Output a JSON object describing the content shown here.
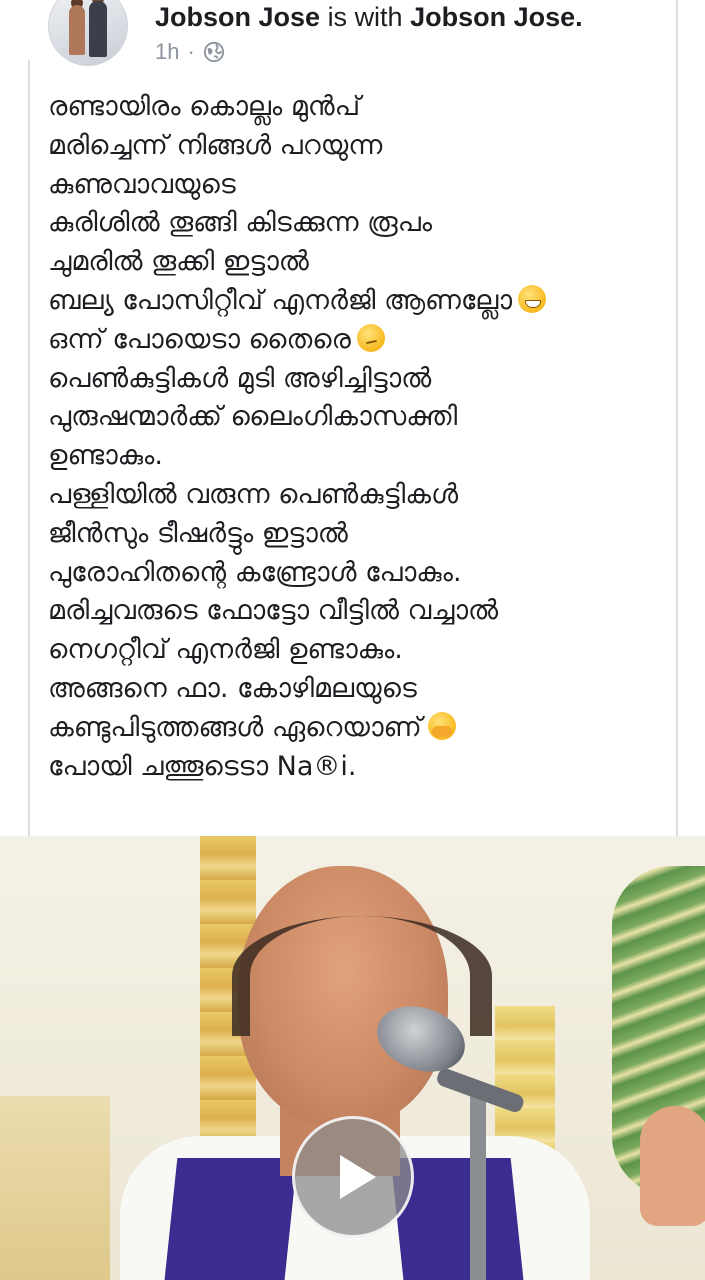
{
  "post": {
    "author_name": "Jobson Jose",
    "connector": "is with",
    "tagged_name": "Jobson Jose.",
    "time": "1h",
    "separator": "·",
    "privacy_icon": "globe-icon",
    "lines": [
      "രണ്ടായിരം കൊല്ലം മുൻപ്",
      "മരിച്ചെന്ന് നിങ്ങൾ പറയുന്ന",
      "കുണുവാവയുടെ",
      "കുരിശിൽ തൂങ്ങി കിടക്കുന്ന രൂപം",
      "ചുമരിൽ തൂക്കി ഇട്ടാൽ",
      "ബല്യ പോസിറ്റീവ് എനർജി ആണല്ലോ",
      "ഒന്ന് പോയെടാ തൈരെ",
      "പെൺകുട്ടികൾ മുടി അഴിച്ചിട്ടാൽ",
      "പുരുഷന്മാർക്ക് ലൈംഗികാസക്തി",
      "ഉണ്ടാകും.",
      "പള്ളിയിൽ വരുന്ന പെൺകുട്ടികൾ",
      "ജീൻസും ടീഷർട്ടും ഇട്ടാൽ",
      "പുരോഹിതന്റെ കണ്ട്രോൾ പോകും.",
      "മരിച്ചവരുടെ ഫോട്ടോ വീട്ടിൽ വച്ചാൽ",
      "നെഗറ്റീവ് എനർജി ഉണ്ടാകും.",
      "അങ്ങനെ ഫാ. കോഴിമലയുടെ",
      "കണ്ടുപിടുത്തങ്ങൾ ഏറെയാണ്",
      "പോയി ചത്തൂടെടാ Na®i."
    ],
    "emojis": {
      "line_6": "grinning-emoji",
      "line_7": "smirking-emoji",
      "line_17": "giggling-emoji"
    }
  },
  "video": {
    "play_icon": "play-icon"
  },
  "colors": {
    "text": "#1c1e21",
    "meta": "#8d949e",
    "border": "#dadde1"
  }
}
